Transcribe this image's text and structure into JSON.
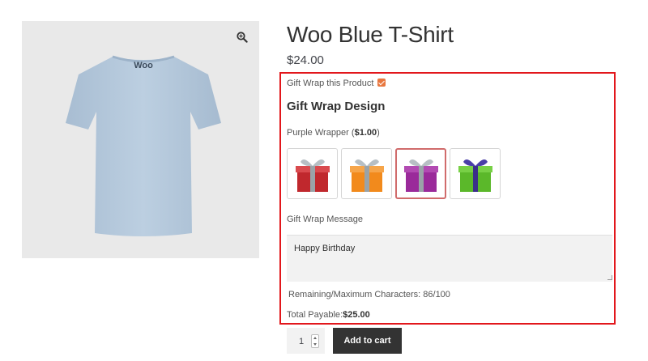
{
  "product": {
    "title": "Woo Blue T-Shirt",
    "price": "$24.00",
    "image": {
      "alt": "Woo Blue T-Shirt back",
      "logo_text": "Woo",
      "background": "#e9e9e9",
      "shirt_color": "#b6c9dc"
    }
  },
  "gift_wrap": {
    "option_label": "Gift Wrap this Product",
    "option_checked": true,
    "design_heading": "Gift Wrap Design",
    "selected_name": "Purple Wrapper",
    "selected_price_open": " (",
    "selected_price": "$1.00",
    "selected_price_close": ")",
    "wrappers": [
      {
        "name": "Red Wrapper",
        "color": "#c0282d",
        "ribbon": "#9aa3a8",
        "selected": false
      },
      {
        "name": "Orange Wrapper",
        "color": "#f28a1c",
        "ribbon": "#9aa3a8",
        "selected": false
      },
      {
        "name": "Purple Wrapper",
        "color": "#9a2a9a",
        "ribbon": "#9aa3a8",
        "selected": true
      },
      {
        "name": "Green Wrapper",
        "color": "#5bb82a",
        "ribbon": "#3b2f8a",
        "selected": false
      }
    ],
    "message_label": "Gift Wrap Message",
    "message_value": "Happy Birthday",
    "remaining_label": "Remaining/Maximum Characters: 86/100",
    "total_label": "Total Payable:",
    "total_value": "$25.00",
    "highlight_color": "#e2171c"
  },
  "cart": {
    "quantity": "1",
    "add_button": "Add to cart",
    "button_color": "#333333"
  }
}
